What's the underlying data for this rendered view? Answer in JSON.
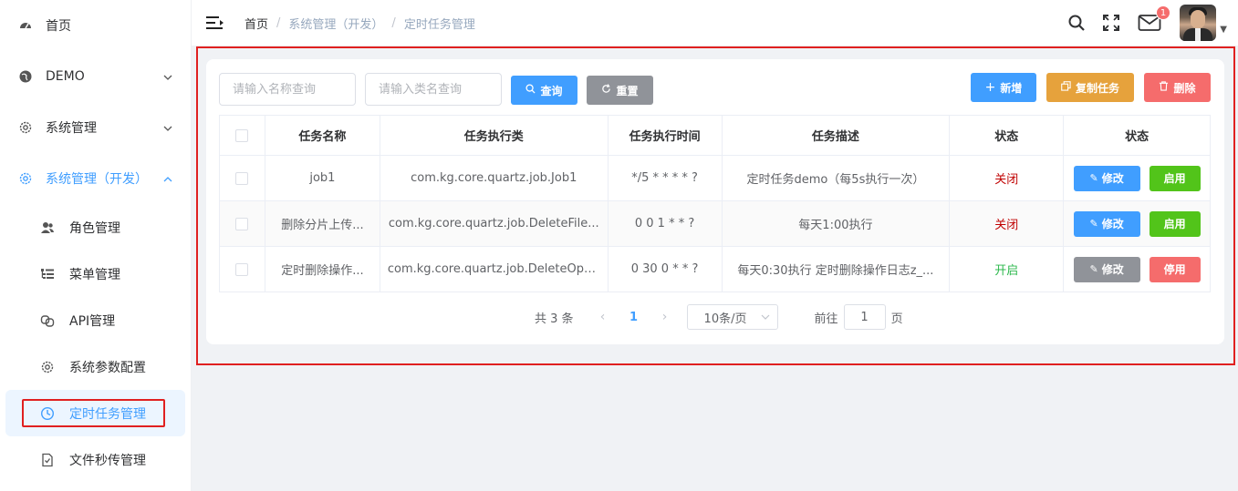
{
  "sidebar": {
    "items": [
      {
        "label": "首页",
        "icon": "dashboard-icon"
      },
      {
        "label": "DEMO",
        "icon": "globe-icon"
      },
      {
        "label": "系统管理",
        "icon": "gear-icon"
      },
      {
        "label": "系统管理（开发）",
        "icon": "gear-icon"
      }
    ],
    "sub_items": [
      {
        "label": "角色管理",
        "icon": "users-icon"
      },
      {
        "label": "菜单管理",
        "icon": "tree-list-icon"
      },
      {
        "label": "API管理",
        "icon": "link-icon"
      },
      {
        "label": "系统参数配置",
        "icon": "gear-icon"
      },
      {
        "label": "定时任务管理",
        "icon": "clock-icon"
      },
      {
        "label": "文件秒传管理",
        "icon": "file-check-icon"
      }
    ]
  },
  "header": {
    "breadcrumb": [
      "首页",
      "系统管理（开发）",
      "定时任务管理"
    ],
    "sep": "/",
    "notification_count": "1"
  },
  "search": {
    "name_placeholder": "请输入名称查询",
    "class_placeholder": "请输入类名查询",
    "query_label": "查询",
    "reset_label": "重置"
  },
  "actions": {
    "add_label": "新增",
    "copy_label": "复制任务",
    "delete_label": "删除"
  },
  "table": {
    "columns": [
      "任务名称",
      "任务执行类",
      "任务执行时间",
      "任务描述",
      "状态",
      "状态"
    ],
    "rows": [
      {
        "name": "job1",
        "class": "com.kg.core.quartz.job.Job1",
        "cron": "*/5 * * * * ?",
        "desc": "定时任务demo（每5s执行一次）",
        "status": "关闭",
        "edit": "修改",
        "toggle": "启用"
      },
      {
        "name": "删除分片上传...",
        "class": "com.kg.core.quartz.job.DeleteFile...",
        "cron": "0 0 1 * * ?",
        "desc": "每天1:00执行",
        "status": "关闭",
        "edit": "修改",
        "toggle": "启用"
      },
      {
        "name": "定时删除操作...",
        "class": "com.kg.core.quartz.job.DeleteOpe...",
        "cron": "0 30 0 * * ?",
        "desc": "每天0:30执行 定时删除操作日志z_...",
        "status": "开启",
        "edit": "修改",
        "toggle": "停用"
      }
    ]
  },
  "pagination": {
    "total": "共 3 条",
    "current_page": "1",
    "page_size": "10条/页",
    "goto_prefix": "前往",
    "goto_value": "1",
    "goto_suffix": "页"
  },
  "colors": {
    "primary": "#409eff",
    "warning": "#e6a23c",
    "danger": "#f56c6c",
    "success": "#52c41a",
    "highlight": "#e02020"
  }
}
